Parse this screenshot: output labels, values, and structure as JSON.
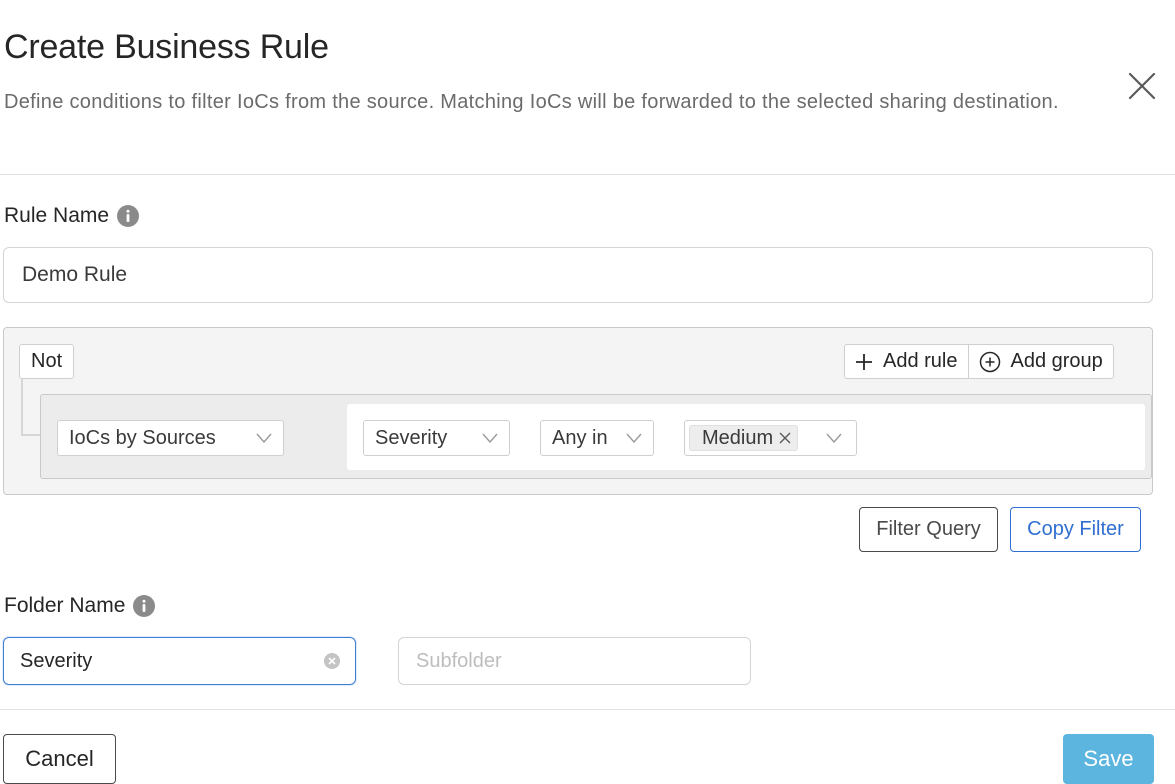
{
  "modal": {
    "title": "Create Business Rule",
    "description": "Define conditions to filter IoCs from the source. Matching IoCs will be forwarded to the selected sharing destination.",
    "close_icon": "close-icon"
  },
  "rule_name": {
    "label": "Rule Name",
    "value": "Demo Rule",
    "info_icon": "info-icon"
  },
  "query_builder": {
    "not_label": "Not",
    "add_rule_label": "Add rule",
    "add_group_label": "Add group",
    "source_select": "IoCs by Sources",
    "field_select": "Severity",
    "operator_select": "Any in",
    "values": [
      "Medium"
    ]
  },
  "actions": {
    "filter_query_label": "Filter Query",
    "copy_filter_label": "Copy Filter"
  },
  "folder": {
    "label": "Folder Name",
    "value": "Severity",
    "subfolder_placeholder": "Subfolder"
  },
  "footer": {
    "cancel_label": "Cancel",
    "save_label": "Save"
  },
  "colors": {
    "primary": "#2f6fd1",
    "save_button": "#5bb5de",
    "focus_border": "#3f7fd8"
  }
}
